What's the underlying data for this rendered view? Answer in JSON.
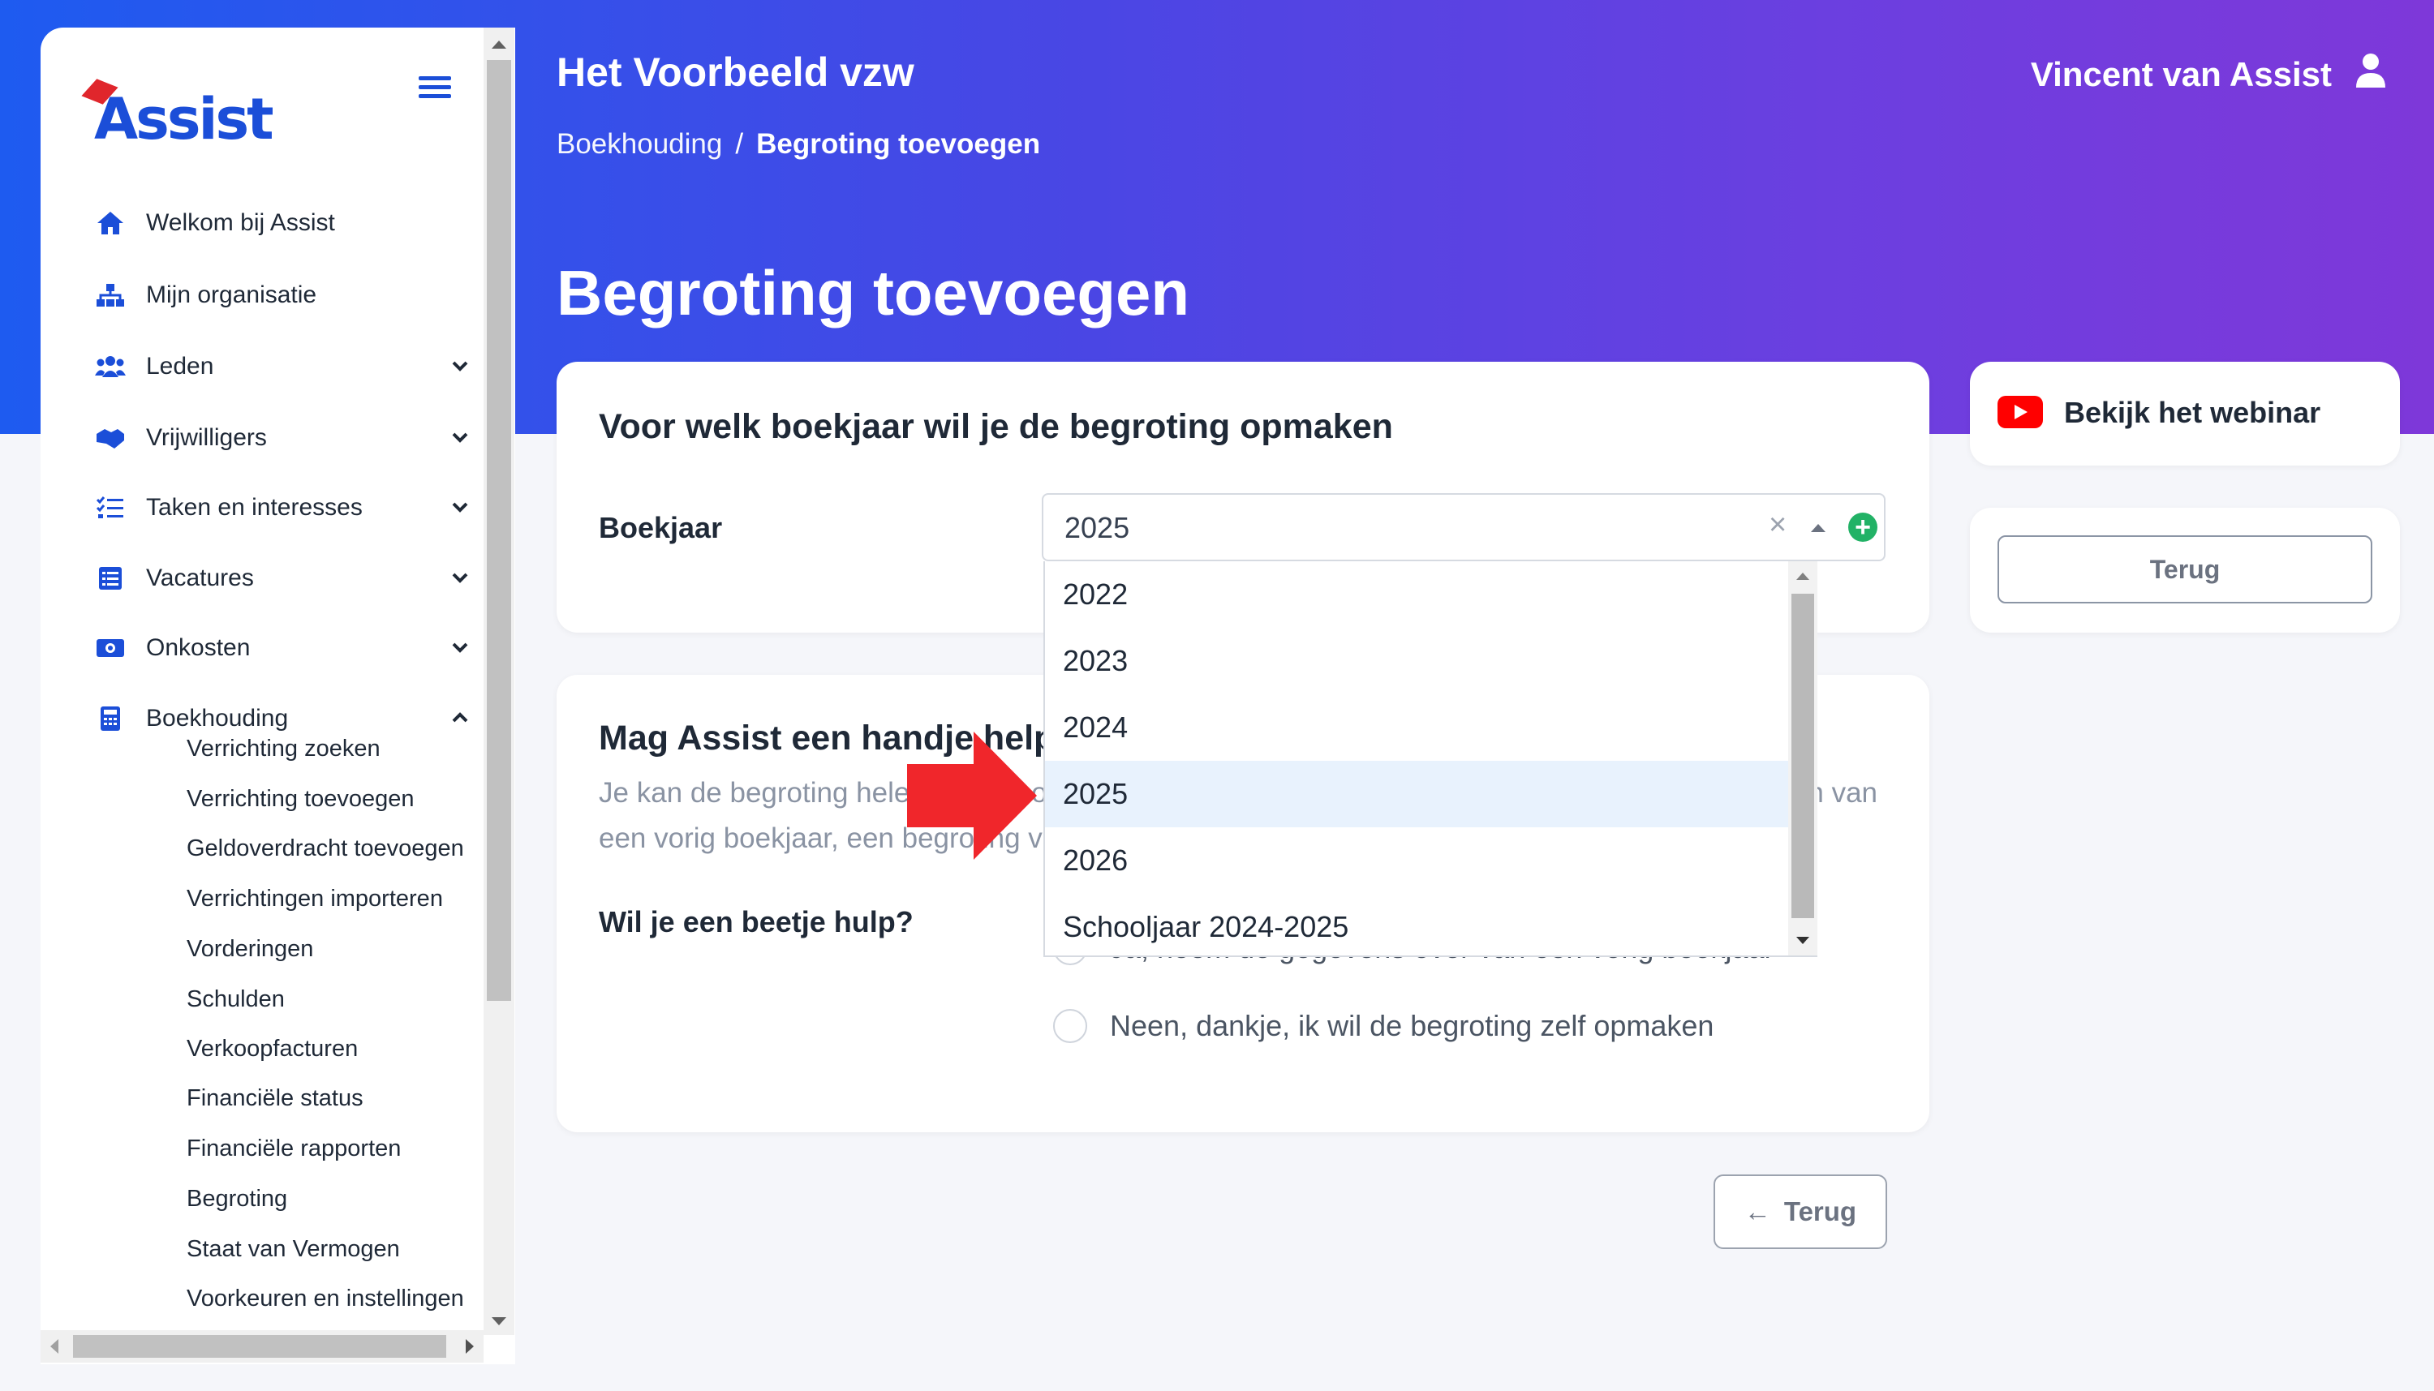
{
  "app": {
    "logo_text": "Assist"
  },
  "header": {
    "org_name": "Het Voorbeeld vzw",
    "breadcrumb": [
      "Boekhouding",
      "/",
      "Begroting toevoegen"
    ],
    "user_name": "Vincent van Assist",
    "page_title": "Begroting toevoegen"
  },
  "sidebar": {
    "items": [
      {
        "label": "Welkom bij Assist",
        "icon": "home-icon"
      },
      {
        "label": "Mijn organisatie",
        "icon": "org-chart-icon"
      },
      {
        "label": "Leden",
        "icon": "users-icon"
      },
      {
        "label": "Vrijwilligers",
        "icon": "handshake-icon"
      },
      {
        "label": "Taken en interesses",
        "icon": "checklist-icon"
      },
      {
        "label": "Vacatures",
        "icon": "list-icon"
      },
      {
        "label": "Onkosten",
        "icon": "money-icon"
      },
      {
        "label": "Boekhouding",
        "icon": "calculator-icon"
      }
    ],
    "sub_items": [
      "Verrichting zoeken",
      "Verrichting toevoegen",
      "Geldoverdracht toevoegen",
      "Verrichtingen importeren",
      "Vorderingen",
      "Schulden",
      "Verkoopfacturen",
      "Financiële status",
      "Financiële rapporten",
      "Begroting",
      "Staat van Vermogen",
      "Voorkeuren en instellingen"
    ]
  },
  "form": {
    "card1_title": "Voor welk boekjaar wil je de begroting opmaken",
    "field_label": "Boekjaar",
    "selected_value": "2025",
    "clear_symbol": "×",
    "add_symbol": "+",
    "options": [
      "2022",
      "2023",
      "2024",
      "2025",
      "2026",
      "Schooljaar 2024-2025"
    ],
    "selected_option_index": 3,
    "card2_title": "Mag Assist een handje helpen?",
    "help_text": "Je kan de begroting helemaal zelf opmaken of Assist kan je helpen door gegevens over te nemen van een vorig boekjaar, een begroting van een vorig boekjaar of de begroting van een vorig boekjaar.",
    "help_question": "Wil je een beetje hulp?",
    "radio_options": [
      "Ja, neem de gegevens over van een vorig boekjaar",
      "Neen, dankje, ik wil de begroting zelf opmaken"
    ],
    "back_label": "Terug",
    "back_arrow": "←"
  },
  "right_panel": {
    "webinar_label": "Bekijk het webinar",
    "back_label": "Terug"
  },
  "colors": {
    "brand_blue": "#1b4ed8",
    "gradient_start": "#1e5bf0",
    "gradient_end": "#7e38d9",
    "success_green": "#22b266",
    "annotation_red": "#f0262b"
  }
}
